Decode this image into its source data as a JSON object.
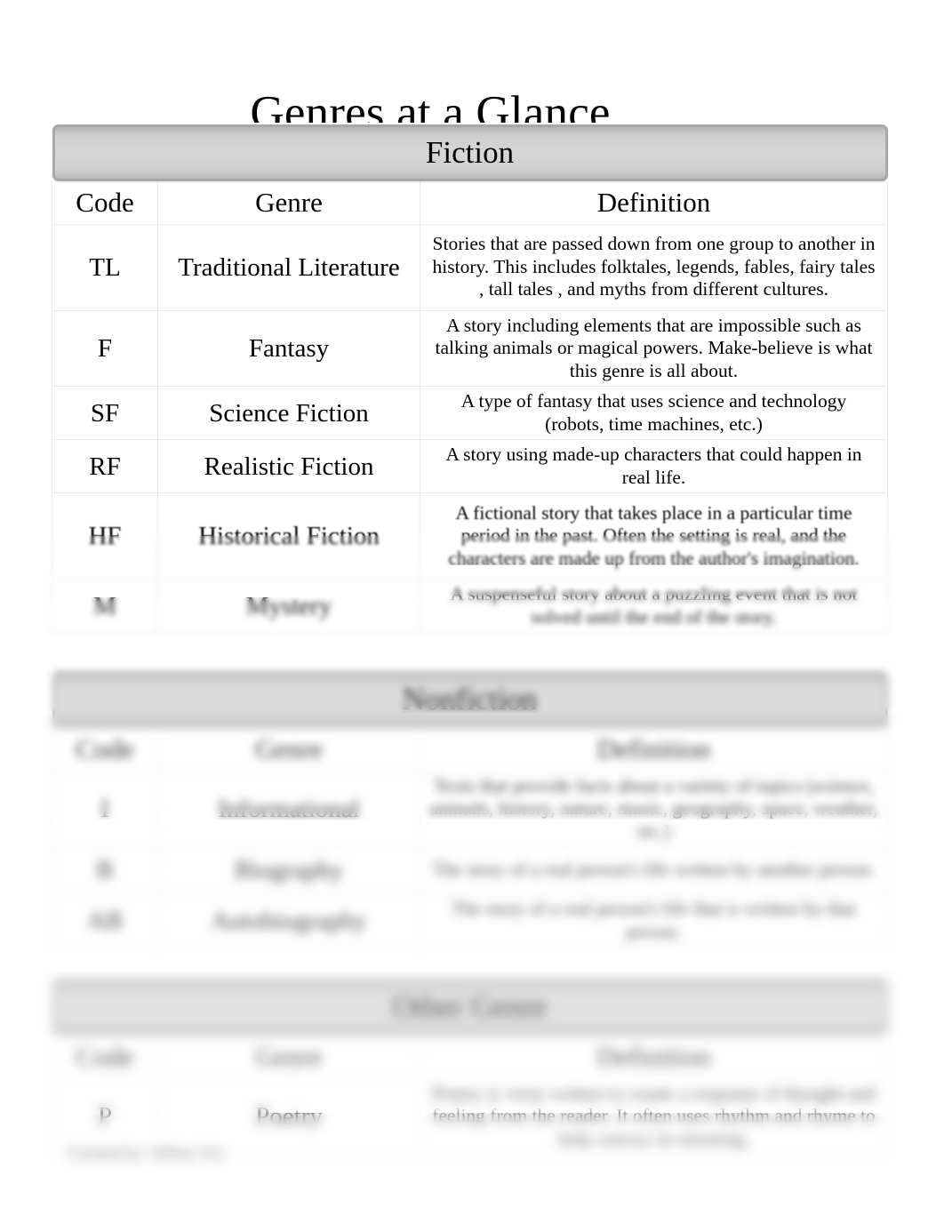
{
  "document": {
    "title": "Genres at a Glance",
    "credit": "Created by: Jeffrey Fry"
  },
  "columns": {
    "code": "Code",
    "genre": "Genre",
    "definition": "Definition"
  },
  "sections": [
    {
      "id": "fiction",
      "banner": "Fiction",
      "rows": [
        {
          "code": "TL",
          "genre": "Traditional Literature",
          "definition": "Stories that are passed down from one group to another in history. This includes      folktales, legends, fables, fairy tales      , tall tales   , and myths    from different cultures."
        },
        {
          "code": "F",
          "genre": "Fantasy",
          "definition": "A story including elements that are impossible such as talking animals or magical powers.       Make-believe   is what this genre is all about."
        },
        {
          "code": "SF",
          "genre": "Science Fiction",
          "definition": "A type of fantasy that uses science and technology (robots, time machines, etc.)"
        },
        {
          "code": "RF",
          "genre": "Realistic Fiction",
          "definition": "A story using made-up characters that could happen in real life."
        },
        {
          "code": "HF",
          "genre": "Historical Fiction",
          "definition": "A fictional story that takes place in a particular time period in the past. Often the setting is real, and the characters are made up from the author's imagination."
        },
        {
          "code": "M",
          "genre": "Mystery",
          "definition": "A suspenseful story about a puzzling event that is not solved until the end of the story."
        }
      ]
    },
    {
      "id": "nonfiction",
      "banner": "Nonfiction",
      "rows": [
        {
          "code": "I",
          "genre": "Informational",
          "definition": "Texts that provide facts about a variety of topics (science, animals, history, nature, music, geography, space, weather, etc.)"
        },
        {
          "code": "B",
          "genre": "Biography",
          "definition": "The story of a real person's life written by another person."
        },
        {
          "code": "AB",
          "genre": "Autobiography",
          "definition": "The story of a real person's life that is written by that person."
        }
      ]
    },
    {
      "id": "other",
      "banner": "Other Genre",
      "rows": [
        {
          "code": "P",
          "genre": "Poetry",
          "definition": "Poetry is verse written to create a response of thought and feeling from the reader. It often uses rhythm and rhyme to help convey its meaning."
        }
      ]
    }
  ]
}
